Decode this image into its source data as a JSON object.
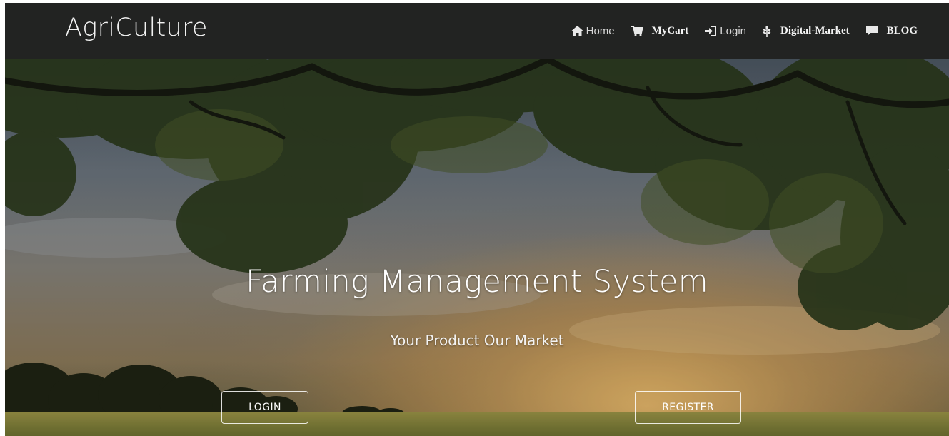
{
  "brand": {
    "name": "AgriCulture"
  },
  "nav": {
    "items": [
      {
        "label": "Home",
        "icon": "home-icon"
      },
      {
        "label": "MyCart",
        "icon": "cart-icon"
      },
      {
        "label": "Login",
        "icon": "login-icon"
      },
      {
        "label": "Digital-Market",
        "icon": "grain-icon"
      },
      {
        "label": "BLOG",
        "icon": "comment-icon"
      }
    ]
  },
  "hero": {
    "title": "Farming Management System",
    "subtitle": "Your Product Our Market",
    "login_label": "LOGIN",
    "register_label": "REGISTER"
  },
  "colors": {
    "navbar_bg": "#222322",
    "nav_text": "#e8e8e8",
    "hero_text": "#ffffff"
  }
}
